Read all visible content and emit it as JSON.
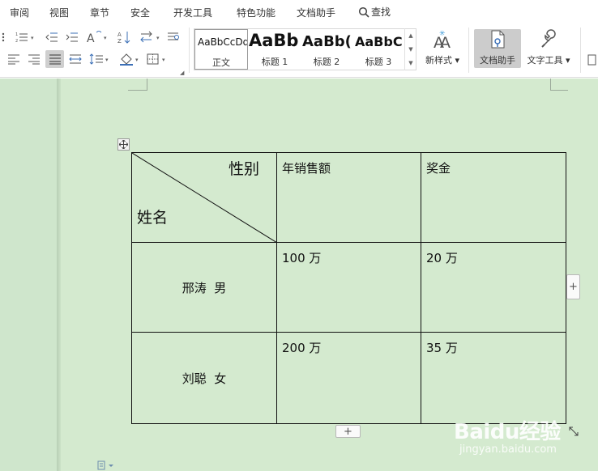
{
  "menubar": {
    "items": [
      "审阅",
      "视图",
      "章节",
      "安全",
      "开发工具",
      "特色功能",
      "文档助手"
    ],
    "search_label": "查找"
  },
  "ribbon": {
    "styles": [
      {
        "preview": "AaBbCcDd",
        "name": "正文"
      },
      {
        "preview": "AaBb",
        "name": "标题 1"
      },
      {
        "preview": "AaBb(",
        "name": "标题 2"
      },
      {
        "preview": "AaBbC(",
        "name": "标题 3"
      }
    ],
    "new_style_label": "新样式",
    "doc_assistant_label": "文档助手",
    "text_tools_label": "文字工具"
  },
  "table": {
    "header": {
      "diag_top": "性别",
      "diag_bottom": "姓名",
      "col2": "年销售额",
      "col3": "奖金"
    },
    "rows": [
      {
        "name": "邢涛  男",
        "sales": "100 万",
        "bonus": "20 万"
      },
      {
        "name": "刘聪  女",
        "sales": "200 万",
        "bonus": "35 万"
      }
    ]
  },
  "controls": {
    "add_symbol": "+"
  },
  "watermark": {
    "logo": "Baidu经验",
    "url": "jingyan.baidu.com"
  }
}
